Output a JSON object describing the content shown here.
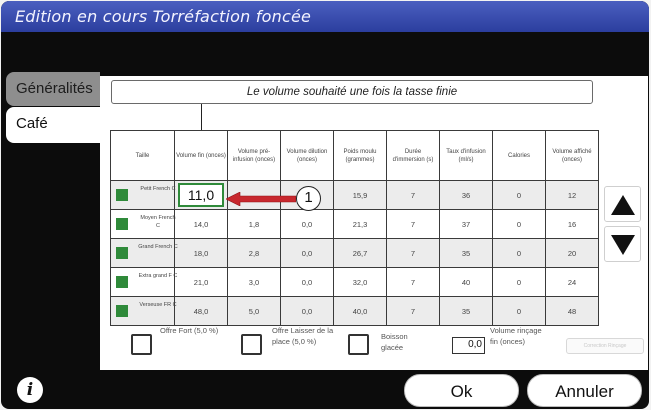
{
  "window": {
    "title": "Edition en cours Torréfaction foncée"
  },
  "tabs": [
    {
      "label": "Généralités",
      "active": false
    },
    {
      "label": "Café",
      "active": true
    }
  ],
  "banner": {
    "text": "Le volume souhaité une fois la tasse finie"
  },
  "table": {
    "headers": [
      "Taille",
      "Volume fin (onces)",
      "Volume pré-infusion (onces)",
      "Volume dilution (onces)",
      "Poids moulu (grammes)",
      "Durée d'immersion (s)",
      "Taux d'infusion (ml/s)",
      "Calories",
      "Volume affiché (onces)"
    ],
    "rows": [
      {
        "size": "Petit French C",
        "cells": [
          "11,0",
          "",
          "0,0",
          "15,9",
          "7",
          "36",
          "0",
          "12"
        ]
      },
      {
        "size": "Moyen French C",
        "cells": [
          "14,0",
          "1,8",
          "0,0",
          "21,3",
          "7",
          "37",
          "0",
          "16"
        ]
      },
      {
        "size": "Grand French C",
        "cells": [
          "18,0",
          "2,8",
          "0,0",
          "26,7",
          "7",
          "35",
          "0",
          "20"
        ]
      },
      {
        "size": "Extra grand F C",
        "cells": [
          "21,0",
          "3,0",
          "0,0",
          "32,0",
          "7",
          "40",
          "0",
          "24"
        ]
      },
      {
        "size": "Verseuse FR C",
        "cells": [
          "48,0",
          "5,0",
          "0,0",
          "40,0",
          "7",
          "35",
          "0",
          "48"
        ]
      }
    ]
  },
  "callout": {
    "number": "1"
  },
  "options": {
    "fort": "Offre Fort (5,0 %)",
    "laisser": "Offre Laisser de la place (5,0 %)",
    "glacee": "Boisson glacée",
    "rincage_value": "0,0",
    "rincage_label": "Volume rinçage fin (onces)",
    "ghost_label": "Correction Rinçage"
  },
  "footer": {
    "info": "i",
    "ok": "Ok",
    "cancel": "Annuler"
  },
  "colors": {
    "titlebar": "#3b4fb0",
    "size_indicator": "#2f8a3a",
    "arrow": "#c8282e"
  }
}
